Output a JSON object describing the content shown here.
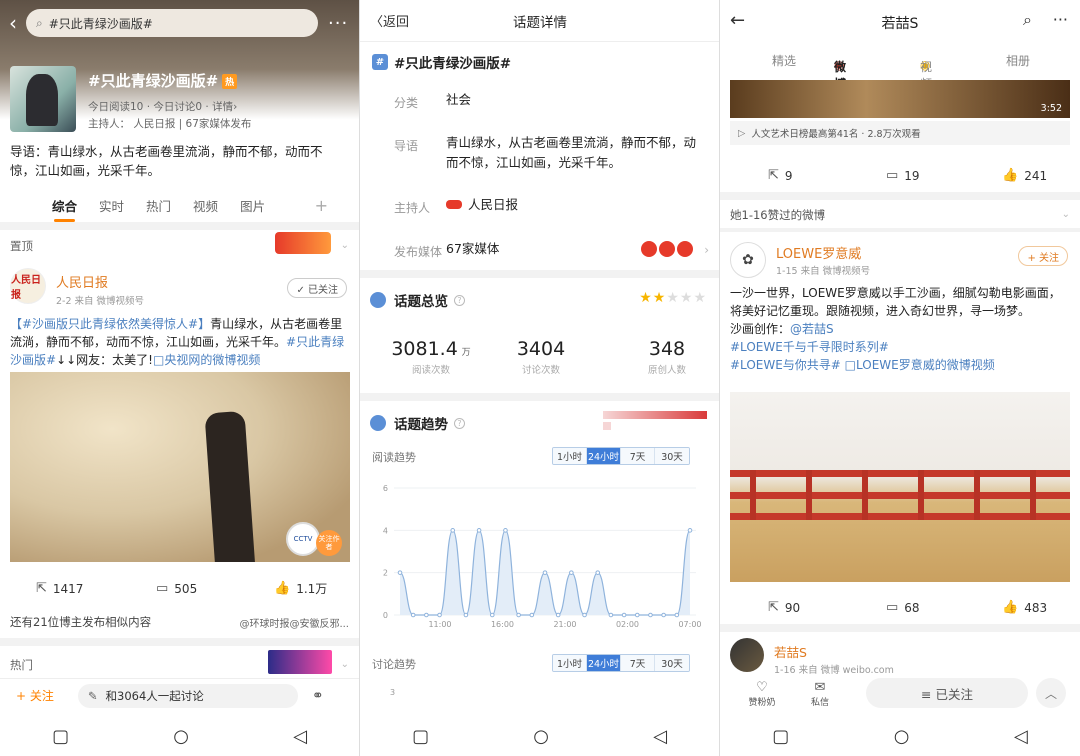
{
  "left": {
    "search_text": "#只此青绿沙画版#",
    "topic_title": "#只此青绿沙画版#",
    "hot_badge": "热",
    "meta": "今日阅读10 · 今日讨论0 · 详情›",
    "host": "主持人：  人民日报 | 67家媒体发布",
    "guide": "导语：青山绿水，从古老画卷里流淌，静而不郁，动而不惊，江山如画，光采千年。",
    "tabs": [
      "综合",
      "实时",
      "热门",
      "视频",
      "图片"
    ],
    "pinned_label": "置顶",
    "post": {
      "avatar_text": "人民日报",
      "author": "人民日报",
      "meta": "2-2 来自 微博视频号",
      "follow": "✓ 已关注",
      "text_link1": "【#沙画版只此青绿依然美得惊人#】",
      "text_body": "青山绿水，从古老画卷里流淌，静而不郁，动而不惊，江山如画，光采千年。",
      "text_link2": "#只此青绿沙画版#",
      "text_tail": "↓↓网友：太美了!",
      "video_link": "□央视网的微博视频",
      "cctv": "CCTV",
      "tag": "关注作者",
      "reposts": "1417",
      "comments": "505",
      "likes": "1.1万"
    },
    "more_bloggers": "还有21位博主发布相似内容",
    "more_source": "@环球时报@安徽反邪...",
    "hot_label": "热门",
    "follow_label": "+ 关注",
    "discuss": "和3064人一起讨论"
  },
  "middle": {
    "back": "〈返回",
    "title": "话题详情",
    "topic": "#只此青绿沙画版#",
    "rows": {
      "category_label": "分类",
      "category": "社会",
      "guide_label": "导语",
      "guide": "青山绿水，从古老画卷里流淌，静而不郁，动而不惊，江山如画，光采千年。",
      "host_label": "主持人",
      "host": "人民日报",
      "media_label": "发布媒体",
      "media": "67家媒体"
    },
    "overview_title": "话题总览",
    "stars": 2,
    "stats": [
      {
        "num": "3081.4",
        "unit": "万",
        "label": "阅读次数"
      },
      {
        "num": "3404",
        "unit": "",
        "label": "讨论次数"
      },
      {
        "num": "348",
        "unit": "",
        "label": "原创人数"
      }
    ],
    "trend_title": "话题趋势",
    "read_trend": "阅读趋势",
    "discuss_trend": "讨论趋势",
    "ranges": [
      "1小时",
      "24小时",
      "7天",
      "30天"
    ],
    "selected_range": "24小时"
  },
  "chart_data": {
    "type": "line",
    "title": "阅读趋势",
    "x_ticks": [
      "11:00",
      "16:00",
      "21:00",
      "02:00",
      "07:00"
    ],
    "y_ticks": [
      0,
      2,
      4,
      6
    ],
    "ylim": [
      0,
      6
    ],
    "series": [
      {
        "values": [
          2,
          0,
          0,
          0,
          4,
          0,
          4,
          0,
          4,
          0,
          0,
          2,
          0,
          2,
          0,
          2,
          0,
          0,
          0,
          0,
          0,
          0,
          4
        ]
      }
    ],
    "discuss_y_ticks": [
      3
    ]
  },
  "right": {
    "title": "若喆S",
    "tabs": [
      "精选",
      "微博",
      "视频",
      "相册"
    ],
    "selected_tab": "微博",
    "video_duration": "3:52",
    "video_info": "人文艺术日榜最高第41名 · 2.8万次观看",
    "post1_actions": {
      "reposts": "9",
      "comments": "19",
      "likes": "241"
    },
    "liked_header": "她1-16赞过的微博",
    "post2": {
      "author": "LOEWE罗意威",
      "meta": "1-15 来自 微博视频号",
      "follow": "+ 关注",
      "text": "一沙一世界，LOEWE罗意威以手工沙画，细腻勾勒电影画面，将美好记忆重现。跟随视频，进入奇幻世界，寻一场梦。",
      "credit": "沙画创作：",
      "credit_link": "@若喆S",
      "tag1": "#LOEWE千与千寻限时系列#",
      "tag2": "#LOEWE与你共寻#",
      "video_link": "□LOEWE罗意威的微博视频",
      "reposts": "90",
      "comments": "68",
      "likes": "483"
    },
    "user2": {
      "name": "若喆S",
      "meta": "1-16 来自 微博 weibo.com"
    },
    "bottom": {
      "fans": "赞粉奶",
      "message": "私信",
      "followed": "≡ 已关注"
    }
  }
}
